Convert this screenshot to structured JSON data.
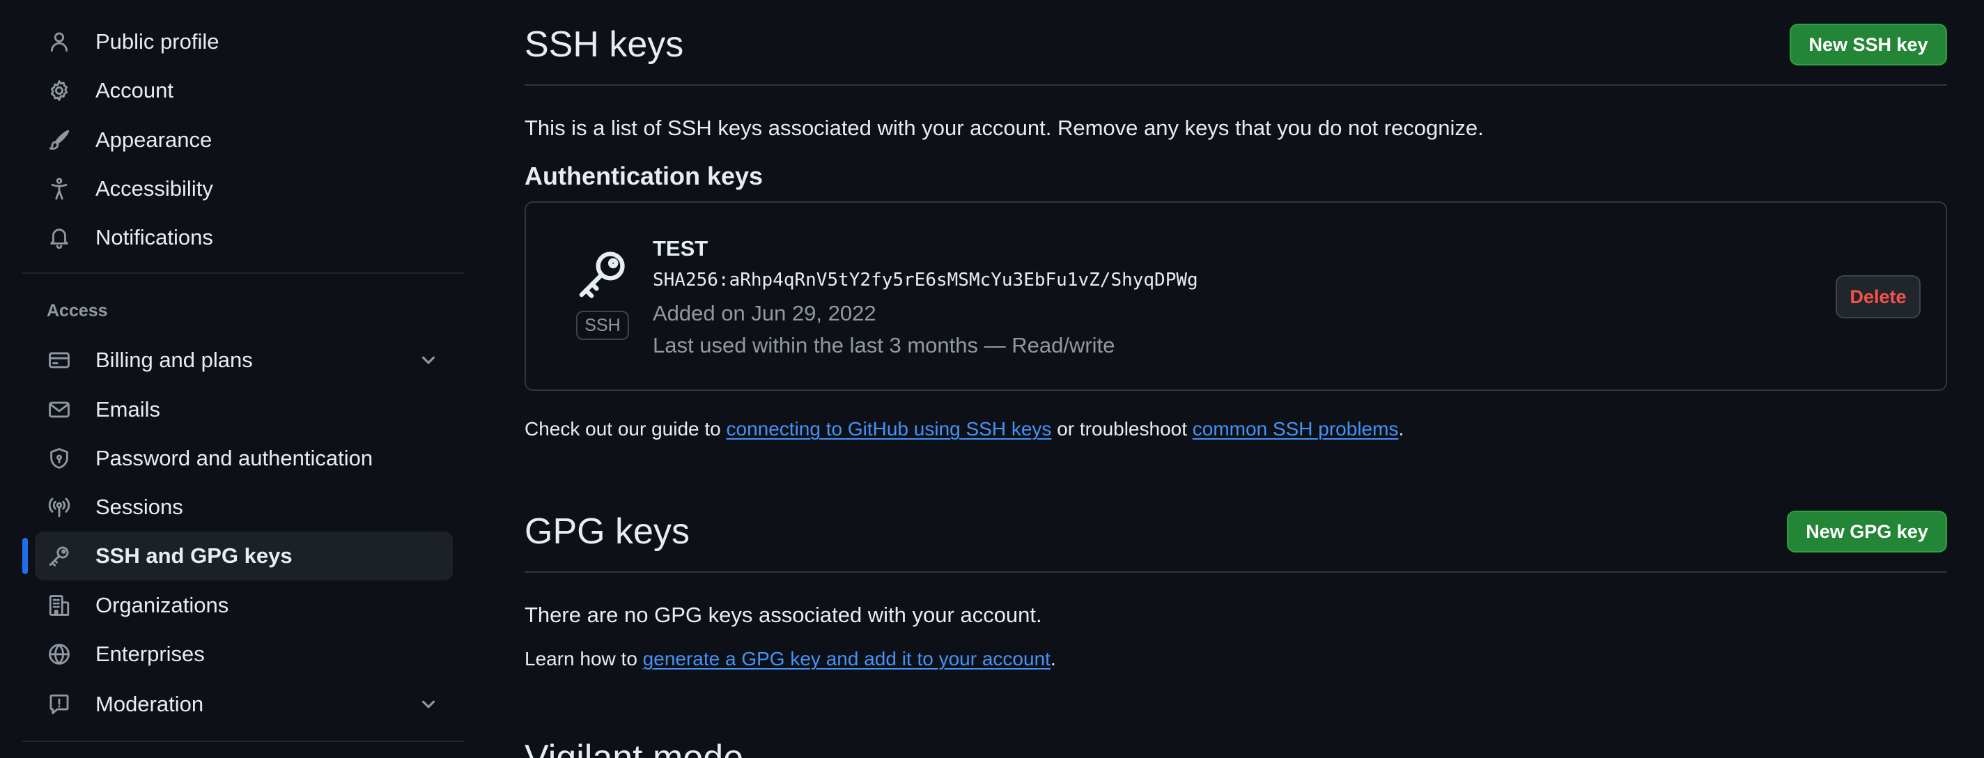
{
  "sidebar": {
    "items_top": [
      {
        "label": "Public profile",
        "icon": "person-icon"
      },
      {
        "label": "Account",
        "icon": "gear-icon"
      },
      {
        "label": "Appearance",
        "icon": "paintbrush-icon"
      },
      {
        "label": "Accessibility",
        "icon": "accessibility-icon"
      },
      {
        "label": "Notifications",
        "icon": "bell-icon"
      }
    ],
    "access_heading": "Access",
    "items_access": [
      {
        "label": "Billing and plans",
        "icon": "credit-card-icon",
        "expandable": true
      },
      {
        "label": "Emails",
        "icon": "mail-icon"
      },
      {
        "label": "Password and authentication",
        "icon": "shield-lock-icon"
      },
      {
        "label": "Sessions",
        "icon": "broadcast-icon"
      },
      {
        "label": "SSH and GPG keys",
        "icon": "key-icon",
        "active": true
      },
      {
        "label": "Organizations",
        "icon": "organization-icon"
      },
      {
        "label": "Enterprises",
        "icon": "globe-icon"
      },
      {
        "label": "Moderation",
        "icon": "report-icon",
        "expandable": true
      }
    ]
  },
  "ssh": {
    "title": "SSH keys",
    "new_button": "New SSH key",
    "description": "This is a list of SSH keys associated with your account. Remove any keys that you do not recognize.",
    "auth_heading": "Authentication keys",
    "key": {
      "name": "TEST",
      "badge": "SSH",
      "fingerprint": "SHA256:aRhp4qRnV5tY2fy5rE6sMSMcYu3EbFu1vZ/ShyqDPWg",
      "added": "Added on Jun 29, 2022",
      "last_used": "Last used within the last 3 months — Read/write",
      "delete_label": "Delete"
    },
    "guide": {
      "prefix": "Check out our guide to ",
      "link1": "connecting to GitHub using SSH keys",
      "middle": " or troubleshoot ",
      "link2": "common SSH problems",
      "suffix": "."
    }
  },
  "gpg": {
    "title": "GPG keys",
    "new_button": "New GPG key",
    "empty": "There are no GPG keys associated with your account.",
    "learn": {
      "prefix": "Learn how to ",
      "link": "generate a GPG key and add it to your account",
      "suffix": "."
    }
  },
  "vigilant": {
    "title": "Vigilant mode"
  },
  "colors": {
    "background": "#0d1117",
    "accent": "#1f6feb",
    "link": "#4493f8",
    "success": "#238636",
    "danger": "#f85149"
  }
}
